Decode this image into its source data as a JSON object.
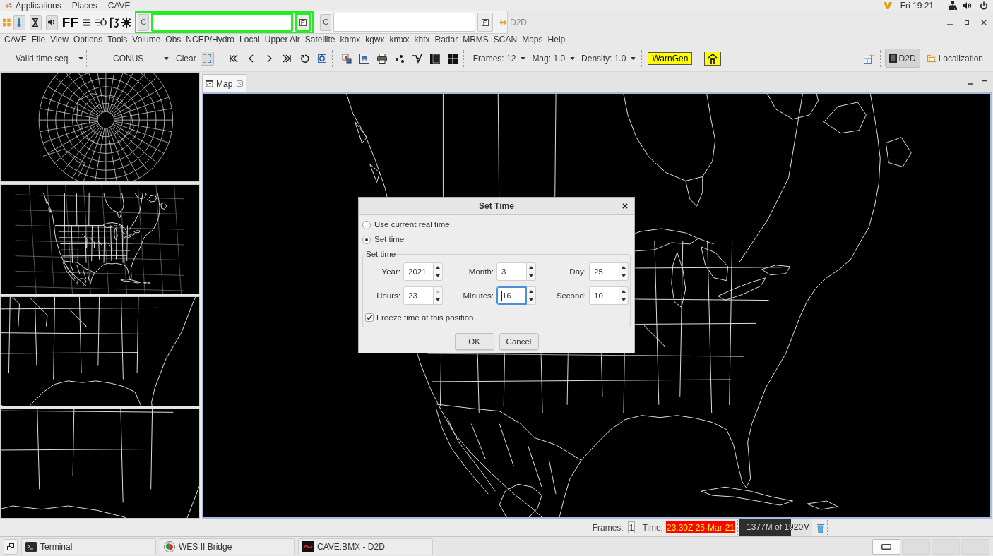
{
  "top_bar": {
    "menus": [
      "Applications",
      "Places",
      "CAVE"
    ],
    "clock": "Fri 19:21"
  },
  "title_bar": {
    "tool_text": "FF",
    "quick_bars": [
      {
        "button": "C",
        "highlighted": true
      },
      {
        "button": "C",
        "highlighted": false
      }
    ],
    "title": "D2D"
  },
  "menu_bar": [
    "CAVE",
    "File",
    "View",
    "Options",
    "Tools",
    "Volume",
    "Obs",
    "NCEP/Hydro",
    "Local",
    "Upper Air",
    "Satellite",
    "kbmx",
    "kgwx",
    "kmxx",
    "khtx",
    "Radar",
    "MRMS",
    "SCAN",
    "Maps",
    "Help"
  ],
  "toolbar": {
    "time_mode": "Valid time seq",
    "scale": "CONUS",
    "clear": "Clear",
    "dropdowns": [
      "Frames: 12",
      "Mag: 1.0",
      "Density: 1.0"
    ],
    "warngen": "WarnGen",
    "perspectives": [
      {
        "label": "D2D",
        "selected": true
      },
      {
        "label": "Localization",
        "selected": false
      }
    ]
  },
  "tabs": [
    {
      "label": "Map",
      "selected": true
    }
  ],
  "dialog": {
    "title": "Set Time",
    "options": [
      {
        "label": "Use current real time",
        "selected": false
      },
      {
        "label": "Set time",
        "selected": true
      }
    ],
    "group": "Set time",
    "fields": [
      {
        "label": "Year:",
        "value": "2021",
        "focused": false,
        "up_disabled": false
      },
      {
        "label": "Month:",
        "value": "3",
        "focused": false,
        "up_disabled": false
      },
      {
        "label": "Day:",
        "value": "25",
        "focused": false,
        "up_disabled": false
      },
      {
        "label": "Hours:",
        "value": "23",
        "focused": false,
        "up_disabled": true
      },
      {
        "label": "Minutes:",
        "value": "16",
        "focused": true,
        "up_disabled": false
      },
      {
        "label": "Second:",
        "value": "10",
        "focused": false,
        "up_disabled": false
      }
    ],
    "freeze": {
      "label": "Freeze time at this position",
      "checked": true
    },
    "buttons": [
      "OK",
      "Cancel"
    ]
  },
  "status_bar": {
    "frames_label": "Frames:",
    "frames": "1",
    "time_label": "Time:",
    "time": "23:30Z 25-Mar-21",
    "memory": {
      "text": "1377M of 1920M",
      "level": 0.71
    }
  },
  "taskbar": {
    "windows": [
      {
        "kind": "terminal",
        "label": "Terminal"
      },
      {
        "kind": "bridge",
        "label": "WES II Bridge"
      },
      {
        "kind": "cave",
        "label": "CAVE:BMX - D2D"
      }
    ],
    "workspaces": [
      {
        "selected": true
      },
      {
        "selected": false
      },
      {
        "selected": false
      },
      {
        "selected": false
      }
    ]
  }
}
